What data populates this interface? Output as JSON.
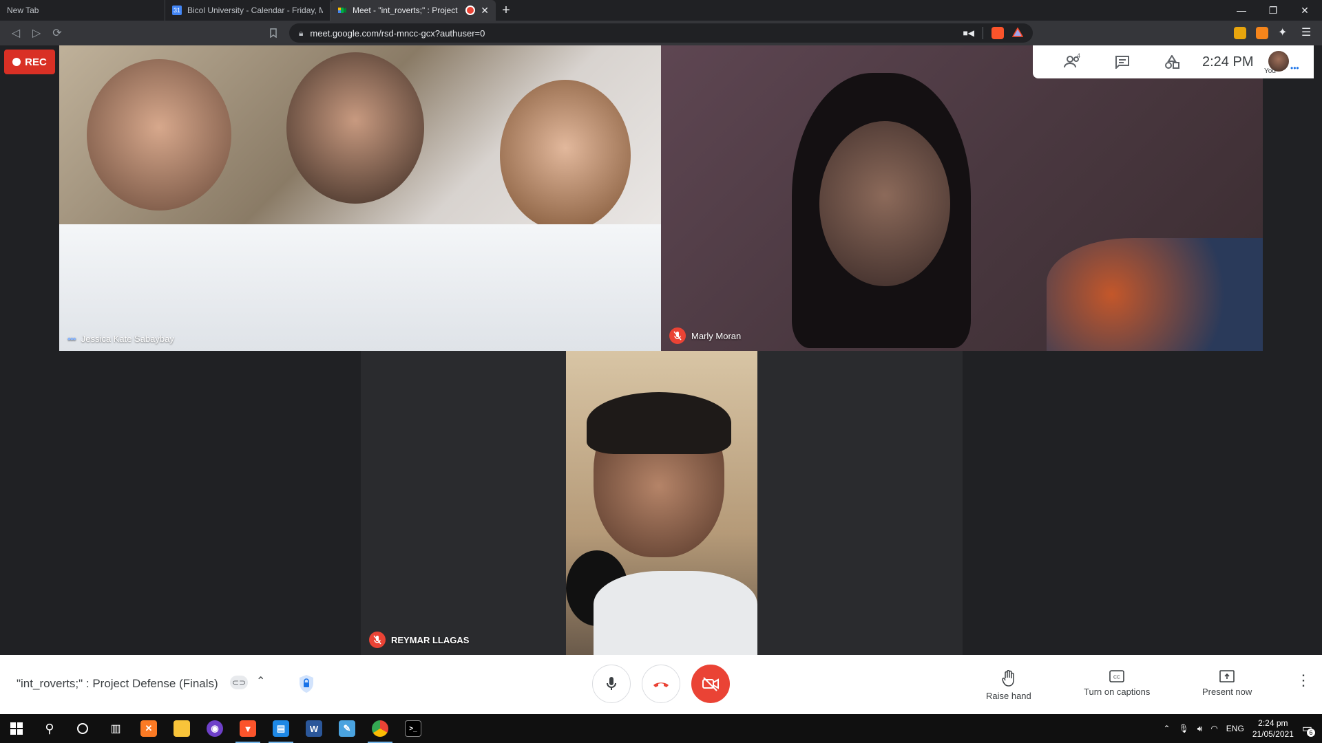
{
  "browser": {
    "tabs": [
      {
        "title": "New Tab",
        "favicon_color": "#202124"
      },
      {
        "title": "Bicol University - Calendar - Friday, M",
        "favicon_color": "#4285f4"
      },
      {
        "title": "Meet - \"int_roverts;\" : Project",
        "favicon_color": "#00897b"
      }
    ],
    "url": "meet.google.com/rsd-mncc-gcx?authuser=0"
  },
  "meet": {
    "rec_label": "REC",
    "people_count": "4",
    "clock": "2:24 PM",
    "you_label": "You",
    "participants": [
      {
        "name": "Jessica Kate Sabaybay",
        "muted": false
      },
      {
        "name": "Marly Moran",
        "muted": true
      },
      {
        "name": "REYMAR LLAGAS",
        "muted": true
      }
    ],
    "meeting_title": "\"int_roverts;\" : Project Defense (Finals)",
    "actions": {
      "raise_hand": "Raise hand",
      "captions": "Turn on captions",
      "present": "Present now"
    },
    "colors": {
      "accent_red": "#ea4335",
      "rec_red": "#d93025",
      "speaking": "#8ab4f8"
    }
  },
  "taskbar": {
    "lang": "ENG",
    "time": "2:24 pm",
    "date": "21/05/2021",
    "notifications": "6"
  }
}
